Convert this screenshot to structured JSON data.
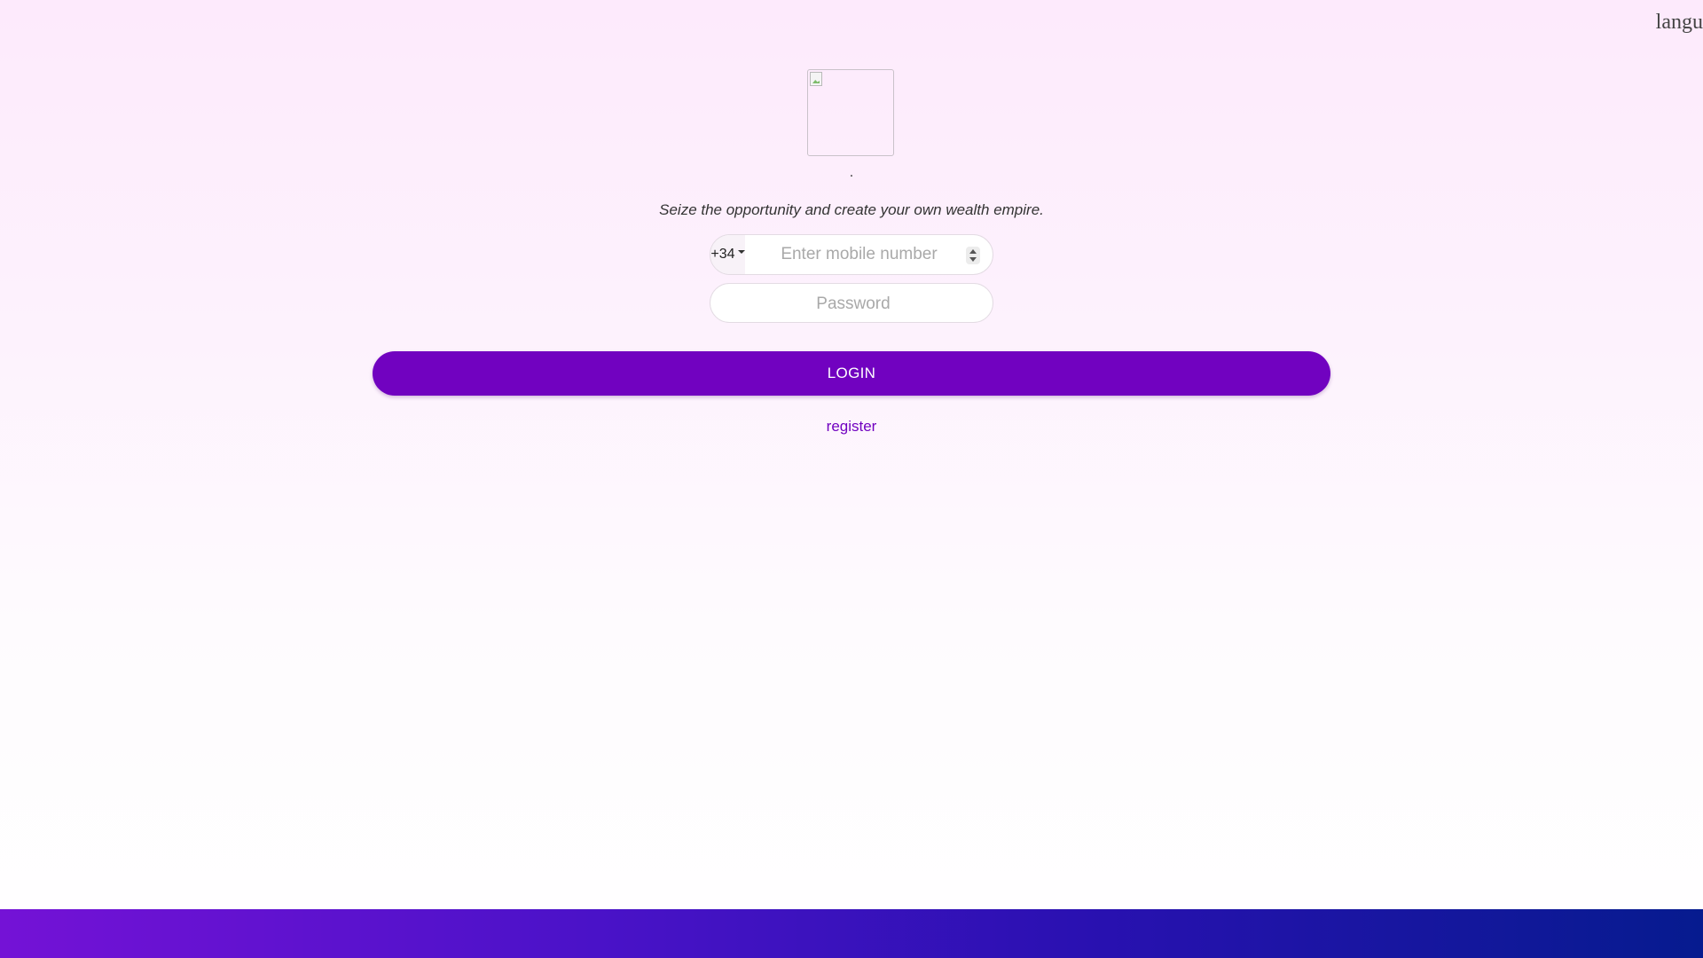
{
  "header": {
    "language_label": "langu"
  },
  "brand": {
    "name": "."
  },
  "tagline": "Seize the opportunity and create your own wealth empire.",
  "form": {
    "country_code": "+34",
    "phone_placeholder": "Enter mobile number",
    "phone_value": "",
    "password_placeholder": "Password",
    "password_value": "",
    "login_label": "LOGIN",
    "register_label": "register"
  },
  "colors": {
    "accent": "#7102c0",
    "footer_gradient_start": "#7412d6",
    "footer_gradient_end": "#061b8f"
  }
}
